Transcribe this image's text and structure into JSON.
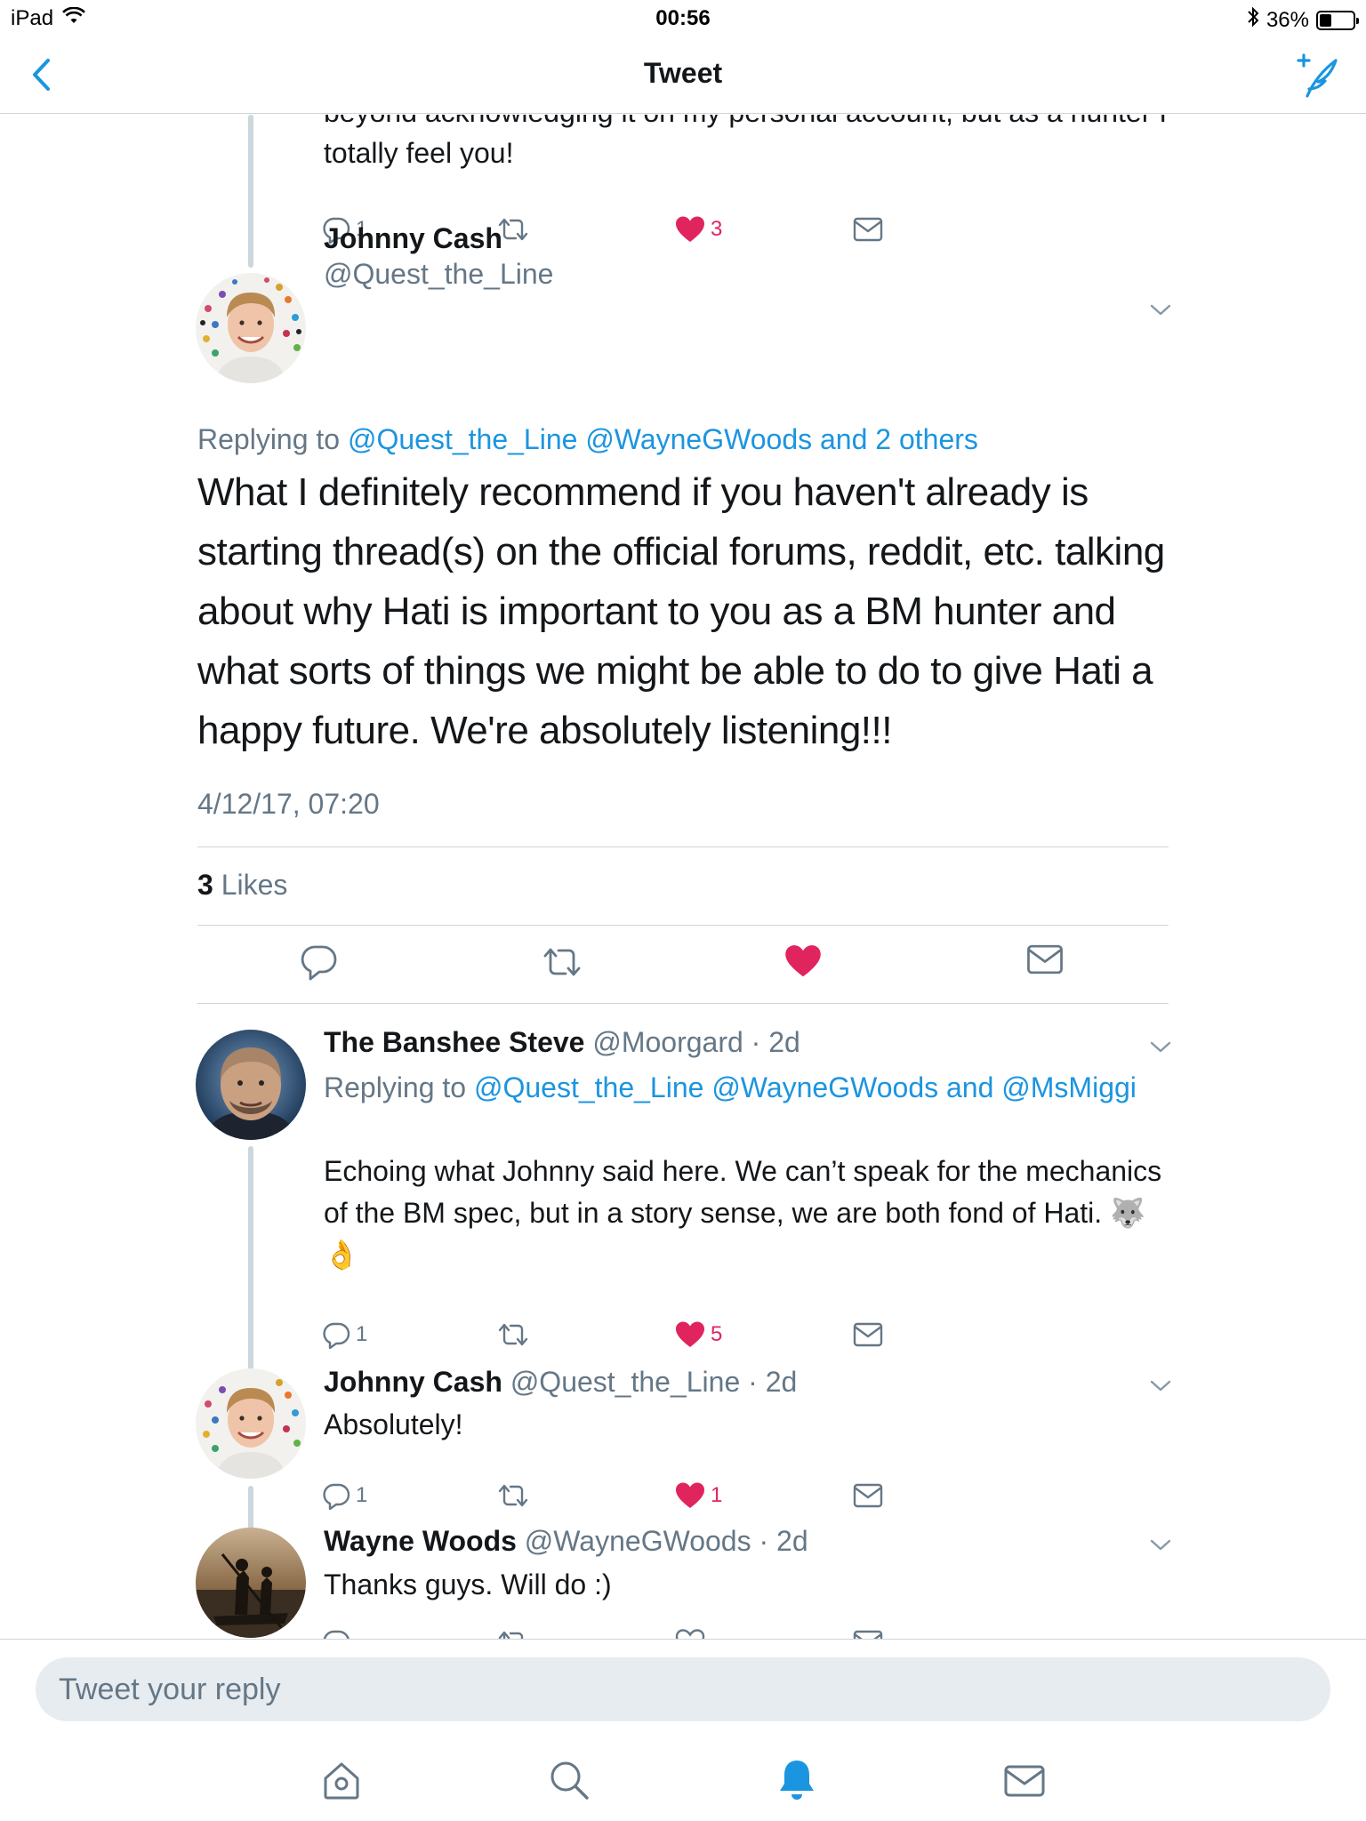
{
  "status_bar": {
    "device": "iPad",
    "time": "00:56",
    "battery": "36%",
    "battery_level": 0.36
  },
  "nav": {
    "title": "Tweet",
    "back_icon": "chevron-left-icon",
    "compose_icon": "compose-tweet-icon"
  },
  "previous_tweet": {
    "text_partial": "beyond acknowledging it on my personal account, but as a hunter I totally feel you!",
    "reply_count": "1",
    "like_count": "3"
  },
  "main_tweet": {
    "name": "Johnny Cash",
    "handle": "@Quest_the_Line",
    "replying_label": "Replying to",
    "replying_to": "@Quest_the_Line @WayneGWoods and 2 others",
    "text": "What I definitely recommend if you haven't already is starting thread(s) on the official forums, reddit, etc. talking about why Hati is important to you as a BM hunter and what sorts of things we might be able to do to give Hati a happy future. We're absolutely listening!!!",
    "timestamp": "4/12/17, 07:20",
    "likes_count": "3",
    "likes_label": "Likes"
  },
  "replies": [
    {
      "name": "The Banshee Steve",
      "meta": "@Moorgard · 2d",
      "replying_label": "Replying to",
      "replying_to": "@Quest_the_Line @WayneGWoods and @MsMiggi",
      "text": "Echoing what Johnny said here. We can’t speak for the mechanics of the BM spec, but in a story sense, we are both fond of Hati. 🐺👌",
      "reply_count": "1",
      "like_count": "5"
    },
    {
      "name": "Johnny Cash",
      "meta": "@Quest_the_Line · 2d",
      "text": "Absolutely!",
      "reply_count": "1",
      "like_count": "1"
    },
    {
      "name": "Wayne Woods",
      "meta": "@WayneGWoods · 2d",
      "text": "Thanks guys. Will do :)"
    }
  ],
  "reply_bar": {
    "placeholder": "Tweet your reply"
  },
  "tabs": [
    "home-icon",
    "search-icon",
    "notifications-icon",
    "messages-icon"
  ],
  "colors": {
    "accent": "#1b95e0",
    "like": "#e0245e",
    "secondary_text": "#657786",
    "divider": "#d0d4d8"
  }
}
